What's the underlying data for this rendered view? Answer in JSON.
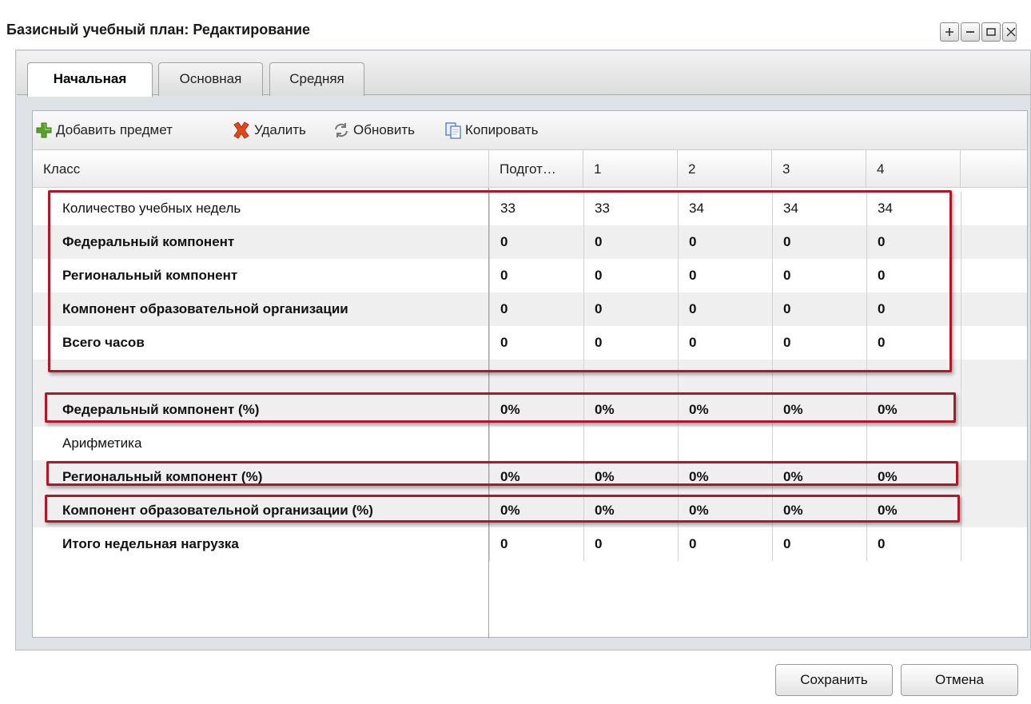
{
  "window": {
    "title": "Базисный учебный план: Редактирование",
    "tools": [
      "plus-icon",
      "minimize-icon",
      "maximize-icon",
      "close-icon"
    ]
  },
  "tabs": [
    {
      "label": "Начальная",
      "active": true
    },
    {
      "label": "Основная",
      "active": false
    },
    {
      "label": "Средняя",
      "active": false
    }
  ],
  "toolbar": {
    "add_label": "Добавить предмет",
    "delete_label": "Удалить",
    "refresh_label": "Обновить",
    "copy_label": "Копировать"
  },
  "grid": {
    "columns": [
      "Класс",
      "Подгот…",
      "1",
      "2",
      "3",
      "4"
    ],
    "rows": [
      {
        "label": "Количество учебных недель",
        "values": [
          "33",
          "33",
          "34",
          "34",
          "34"
        ],
        "bold": false
      },
      {
        "label": "Федеральный компонент",
        "values": [
          "0",
          "0",
          "0",
          "0",
          "0"
        ],
        "bold": true
      },
      {
        "label": "Региональный компонент",
        "values": [
          "0",
          "0",
          "0",
          "0",
          "0"
        ],
        "bold": true
      },
      {
        "label": "Компонент образовательной организации",
        "values": [
          "0",
          "0",
          "0",
          "0",
          "0"
        ],
        "bold": true
      },
      {
        "label": "Всего часов",
        "values": [
          "0",
          "0",
          "0",
          "0",
          "0"
        ],
        "bold": true
      },
      {
        "label": "",
        "values": [
          "",
          "",
          "",
          "",
          ""
        ],
        "bold": false
      },
      {
        "label": "Федеральный компонент (%)",
        "values": [
          "0%",
          "0%",
          "0%",
          "0%",
          "0%"
        ],
        "bold": true
      },
      {
        "label": "Арифметика",
        "values": [
          "",
          "",
          "",
          "",
          ""
        ],
        "bold": false
      },
      {
        "label": "Региональный компонент (%)",
        "values": [
          "0%",
          "0%",
          "0%",
          "0%",
          "0%"
        ],
        "bold": true
      },
      {
        "label": "Компонент образовательной организации (%)",
        "values": [
          "0%",
          "0%",
          "0%",
          "0%",
          "0%"
        ],
        "bold": true
      },
      {
        "label": "Итого недельная нагрузка",
        "values": [
          "0",
          "0",
          "0",
          "0",
          "0"
        ],
        "bold": true
      }
    ]
  },
  "footer": {
    "save_label": "Сохранить",
    "cancel_label": "Отмена"
  },
  "colors": {
    "highlight": "#b0182a",
    "row_alt": "#efefef",
    "add_icon": "#5aa02c",
    "delete_icon": "#e04a1a"
  }
}
